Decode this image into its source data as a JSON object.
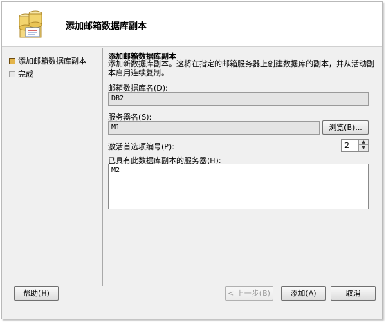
{
  "wizard": {
    "title": "添加邮箱数据库副本"
  },
  "nav": {
    "items": [
      {
        "label": "添加邮箱数据库副本",
        "state": "active"
      },
      {
        "label": "完成",
        "state": "pending"
      }
    ]
  },
  "section": {
    "title": "添加邮箱数据库副本",
    "description": "添加新数据库副本。这将在指定的邮箱服务器上创建数据库的副本，并从活动副本启用连续复制。"
  },
  "form": {
    "db_name_label": "邮箱数据库名(D):",
    "db_name_value": "DB2",
    "server_label": "服务器名(S):",
    "server_value": "M1",
    "browse_label": "浏览(B)...",
    "preference_label": "激活首选项编号(P):",
    "preference_value": "2",
    "existing_label": "已具有此数据库副本的服务器(H):",
    "existing_servers": "M2"
  },
  "buttons": {
    "help": "帮助(H)",
    "back": "< 上一步(B)",
    "add": "添加(A)",
    "cancel": "取消"
  },
  "colors": {
    "active_bullet": "#e3b44a",
    "field_bg": "#e4e4e4"
  }
}
